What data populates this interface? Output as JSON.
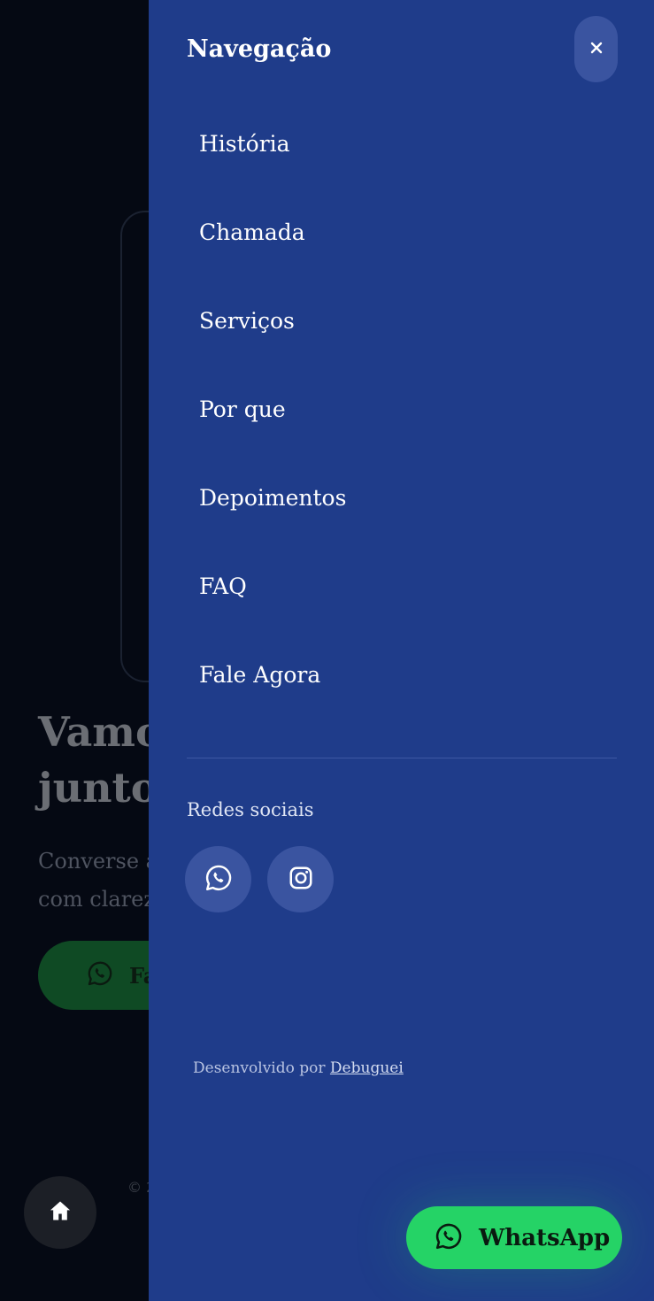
{
  "background": {
    "headline": "Vamos\njuntos",
    "subtitle": "Converse a\ncom clarez",
    "cta_label": "Fa",
    "copyright": "© 2"
  },
  "drawer": {
    "title": "Navegação",
    "close_icon": "close-icon",
    "nav_items": [
      {
        "label": "História"
      },
      {
        "label": "Chamada"
      },
      {
        "label": "Serviços"
      },
      {
        "label": "Por que"
      },
      {
        "label": "Depoimentos"
      },
      {
        "label": "FAQ"
      },
      {
        "label": "Fale Agora"
      }
    ],
    "social_title": "Redes sociais",
    "social_links": [
      {
        "icon": "whatsapp-icon"
      },
      {
        "icon": "instagram-icon"
      }
    ],
    "credit_prefix": "Desenvolvido por",
    "credit_link": "Debuguei"
  },
  "floating_whatsapp": {
    "label": "WhatsApp",
    "icon": "whatsapp-icon"
  },
  "home_button": {
    "icon": "home-icon"
  },
  "colors": {
    "drawer_bg": "#1f3c8a",
    "button_bg": "#3a54a0",
    "whatsapp_green": "#25d366"
  }
}
